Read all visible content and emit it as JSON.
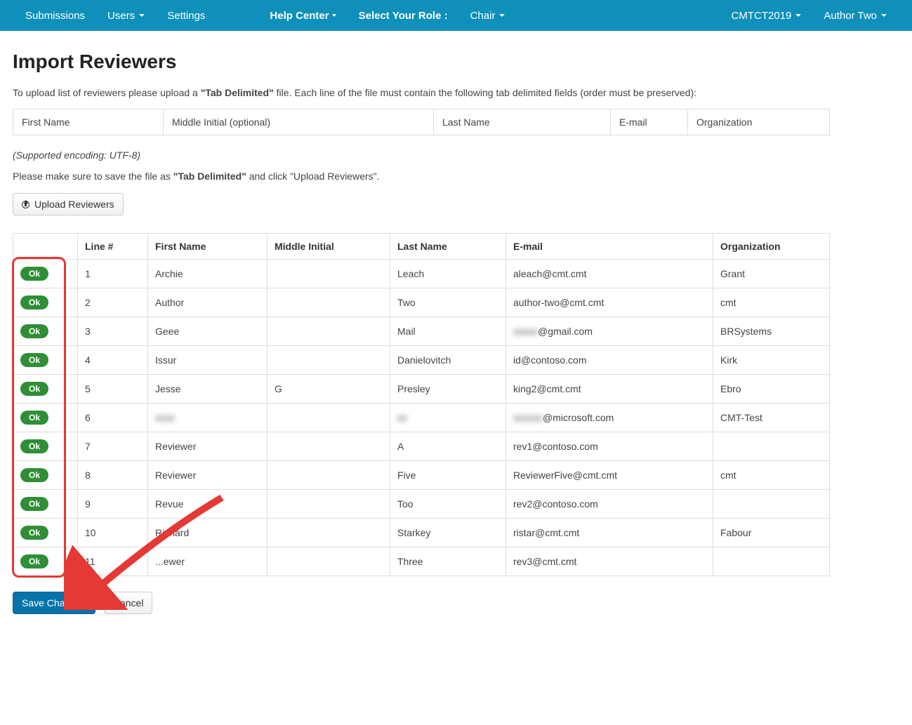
{
  "nav": {
    "submissions": "Submissions",
    "users": "Users",
    "settings": "Settings",
    "help": "Help Center",
    "role_label": "Select Your Role :",
    "role_value": "Chair",
    "conf": "CMTCT2019",
    "user": "Author Two"
  },
  "page": {
    "title": "Import Reviewers",
    "desc_1": "To upload list of reviewers please upload a ",
    "desc_bold": "\"Tab Delimited\"",
    "desc_2": " file. Each line of the file must contain the following tab delimited fields (order must be preserved):",
    "fields": {
      "f1": "First Name",
      "f2": "Middle Initial (optional)",
      "f3": "Last Name",
      "f4": "E-mail",
      "f5": "Organization"
    },
    "encoding_note": "(Supported encoding: UTF-8)",
    "save_note_1": "Please make sure to save the file as ",
    "save_note_bold": "\"Tab Delimited\"",
    "save_note_2": " and click \"Upload Reviewers\".",
    "upload_btn": "Upload Reviewers",
    "save_btn": "Save Changes",
    "cancel_btn": "Cancel"
  },
  "table": {
    "headers": {
      "status": "",
      "line": "Line #",
      "first": "First Name",
      "middle": "Middle Initial",
      "last": "Last Name",
      "email": "E-mail",
      "org": "Organization"
    },
    "ok_label": "Ok",
    "rows": [
      {
        "line": "1",
        "first": "Archie",
        "middle": "",
        "last": "Leach",
        "email": "aleach@cmt.cmt",
        "org": "Grant",
        "blur_first": false,
        "blur_last": false,
        "email_prefix": "",
        "email_blur": false
      },
      {
        "line": "2",
        "first": "Author",
        "middle": "",
        "last": "Two",
        "email": "author-two@cmt.cmt",
        "org": "cmt",
        "blur_first": false,
        "blur_last": false,
        "email_prefix": "",
        "email_blur": false
      },
      {
        "line": "3",
        "first": "Geee",
        "middle": "",
        "last": "Mail",
        "email": "@gmail.com",
        "org": "BRSystems",
        "blur_first": false,
        "blur_last": false,
        "email_prefix": "xxxxx",
        "email_blur": true
      },
      {
        "line": "4",
        "first": "Issur",
        "middle": "",
        "last": "Danielovitch",
        "email": "id@contoso.com",
        "org": "Kirk",
        "blur_first": false,
        "blur_last": false,
        "email_prefix": "",
        "email_blur": false
      },
      {
        "line": "5",
        "first": "Jesse",
        "middle": "G",
        "last": "Presley",
        "email": "king2@cmt.cmt",
        "org": "Ebro",
        "blur_first": false,
        "blur_last": false,
        "email_prefix": "",
        "email_blur": false
      },
      {
        "line": "6",
        "first": "xxxx",
        "middle": "",
        "last": "xx",
        "email": "@microsoft.com",
        "org": "CMT-Test",
        "blur_first": true,
        "blur_last": true,
        "email_prefix": "xxxxxx",
        "email_blur": true
      },
      {
        "line": "7",
        "first": "Reviewer",
        "middle": "",
        "last": "A",
        "email": "rev1@contoso.com",
        "org": "",
        "blur_first": false,
        "blur_last": false,
        "email_prefix": "",
        "email_blur": false
      },
      {
        "line": "8",
        "first": "Reviewer",
        "middle": "",
        "last": "Five",
        "email": "ReviewerFive@cmt.cmt",
        "org": "cmt",
        "blur_first": false,
        "blur_last": false,
        "email_prefix": "",
        "email_blur": false
      },
      {
        "line": "9",
        "first": "Revue",
        "middle": "",
        "last": "Too",
        "email": "rev2@contoso.com",
        "org": "",
        "blur_first": false,
        "blur_last": false,
        "email_prefix": "",
        "email_blur": false
      },
      {
        "line": "10",
        "first": "Richard",
        "middle": "",
        "last": "Starkey",
        "email": "ristar@cmt.cmt",
        "org": "Fabour",
        "blur_first": false,
        "blur_last": false,
        "email_prefix": "",
        "email_blur": false
      },
      {
        "line": "11",
        "first": "...ewer",
        "middle": "",
        "last": "Three",
        "email": "rev3@cmt.cmt",
        "org": "",
        "blur_first": false,
        "blur_last": false,
        "email_prefix": "",
        "email_blur": false
      }
    ]
  },
  "colors": {
    "navbar": "#0e90ba",
    "ok_badge": "#2f8e36",
    "primary_btn": "#0773aa",
    "highlight": "#e53935"
  }
}
